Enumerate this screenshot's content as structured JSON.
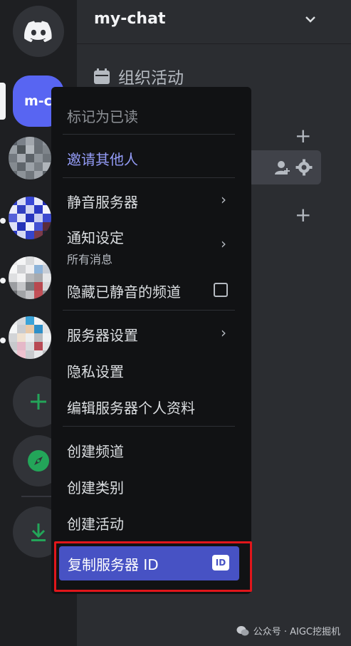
{
  "header": {
    "server_name": "my-chat"
  },
  "channels": {
    "events_label": "组织活动"
  },
  "rail": {
    "active_server_label": "m-c"
  },
  "menu": {
    "mark_read": "标记为已读",
    "invite": "邀请其他人",
    "mute_server": "静音服务器",
    "notification_settings": "通知设定",
    "notification_value": "所有消息",
    "hide_muted": "隐藏已静音的频道",
    "server_settings": "服务器设置",
    "privacy_settings": "隐私设置",
    "edit_profile": "编辑服务器个人资料",
    "create_channel": "创建频道",
    "create_category": "创建类别",
    "create_event": "创建活动",
    "copy_server_id": "复制服务器 ID",
    "id_badge": "ID"
  },
  "watermark": {
    "text": "公众号 · AIGC挖掘机"
  },
  "colors": {
    "accent": "#5865f2",
    "highlight_box": "#e0161b",
    "menu_bg": "#111214"
  }
}
